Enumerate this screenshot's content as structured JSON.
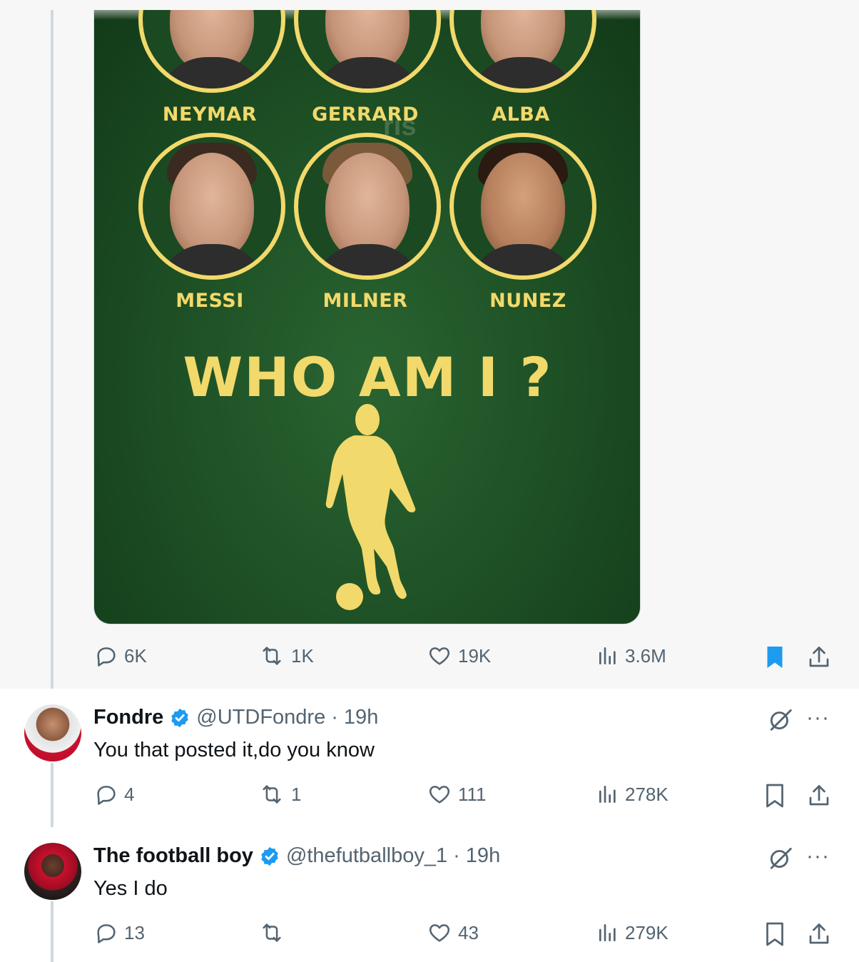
{
  "post": {
    "image": {
      "players_row1": [
        "NEYMAR",
        "GERRARD",
        "ALBA"
      ],
      "players_row2": [
        "MESSI",
        "MILNER",
        "NUNEZ"
      ],
      "watermark": "ris",
      "headline": "WHO AM I ?"
    },
    "stats": {
      "replies": "6K",
      "reposts": "1K",
      "likes": "19K",
      "views": "3.6M"
    },
    "bookmarked": true
  },
  "replies": [
    {
      "name": "Fondre",
      "handle": "@UTDFondre",
      "time": "· 19h",
      "text": "You that posted it,do you know",
      "replies": "4",
      "reposts": "1",
      "likes": "111",
      "views": "278K",
      "verified": true
    },
    {
      "name": "The football boy",
      "handle": "@thefutballboy_1",
      "time": "· 19h",
      "text": "Yes I do",
      "replies": "13",
      "reposts": "",
      "likes": "43",
      "views": "279K",
      "verified": true
    }
  ],
  "colors": {
    "accent": "#1d9bf0",
    "muted": "#536471",
    "card_yellow": "#f2d96b",
    "card_green": "#1f5226"
  },
  "icons": [
    "reply-icon",
    "repost-icon",
    "like-icon",
    "views-icon",
    "bookmark-icon",
    "share-icon",
    "grok-icon",
    "more-icon",
    "verified-icon"
  ],
  "more_label": "···"
}
